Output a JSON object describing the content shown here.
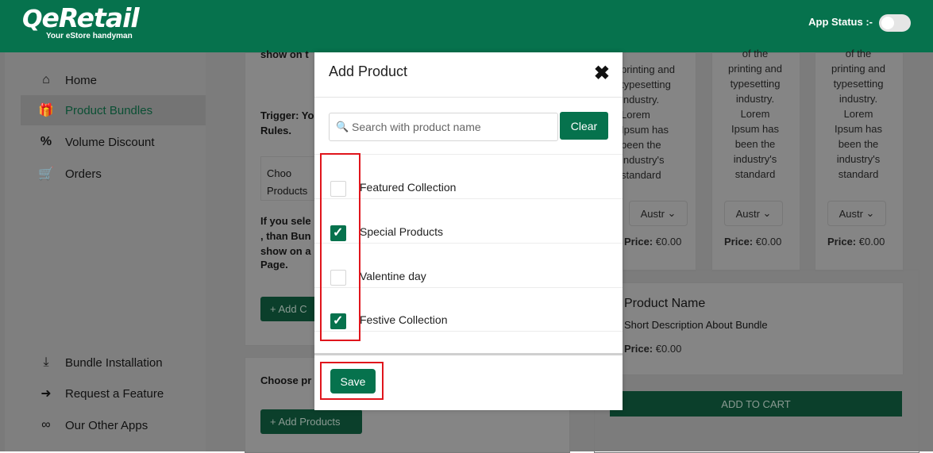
{
  "header": {
    "logo_text": "eRetail",
    "logo_tagline": "Your eStore handyman",
    "app_status_label": "App Status :-"
  },
  "sidebar": {
    "items": [
      {
        "label": "Home",
        "icon": "home-icon",
        "glyph": "⌂"
      },
      {
        "label": "Product Bundles",
        "icon": "gift-icon",
        "glyph": "⌸"
      },
      {
        "label": "Volume Discount",
        "icon": "percent-icon",
        "glyph": "%"
      },
      {
        "label": "Orders",
        "icon": "cart-icon",
        "glyph": "⛟"
      }
    ],
    "bottom_items": [
      {
        "label": "Bundle Installation",
        "icon": "download-icon",
        "glyph": "⤓"
      },
      {
        "label": "Request a Feature",
        "icon": "arrow-circle-icon",
        "glyph": "➜"
      },
      {
        "label": "Our Other Apps",
        "icon": "link-icon",
        "glyph": "∞"
      }
    ]
  },
  "background": {
    "snippet_top": "show on t",
    "trigger": "Trigger: Yo",
    "rules": "Rules.",
    "choose_box_1": "Choo",
    "choose_box_2": "Products",
    "info_lines": [
      "If you sele",
      ", than Bun",
      "show on a",
      "Page."
    ],
    "add_btn_partial": "+ Add C",
    "choose_pr": "Choose pr",
    "add_products": "+ Add Products",
    "product_desc_lines": [
      "of the",
      "printing and",
      "typesetting",
      "industry.",
      "Lorem",
      "Ipsum has",
      "been the",
      "industry's",
      "standard"
    ],
    "select_value": "Austr",
    "price_label": "Price:",
    "price_value": "€0.00",
    "bundle_name": "Product Name",
    "bundle_desc": "Short Description About Bundle",
    "add_to_cart": "ADD TO CART"
  },
  "modal": {
    "title": "Add Product",
    "search_placeholder": "Search with product name",
    "clear_label": "Clear",
    "save_label": "Save",
    "items": [
      {
        "label": "Featured Collection",
        "checked": false
      },
      {
        "label": "Special Products",
        "checked": true
      },
      {
        "label": "Valentine day",
        "checked": false
      },
      {
        "label": "Festive Collection",
        "checked": true
      }
    ]
  },
  "colors": {
    "brand": "#06724d",
    "highlight": "#e0151c"
  }
}
